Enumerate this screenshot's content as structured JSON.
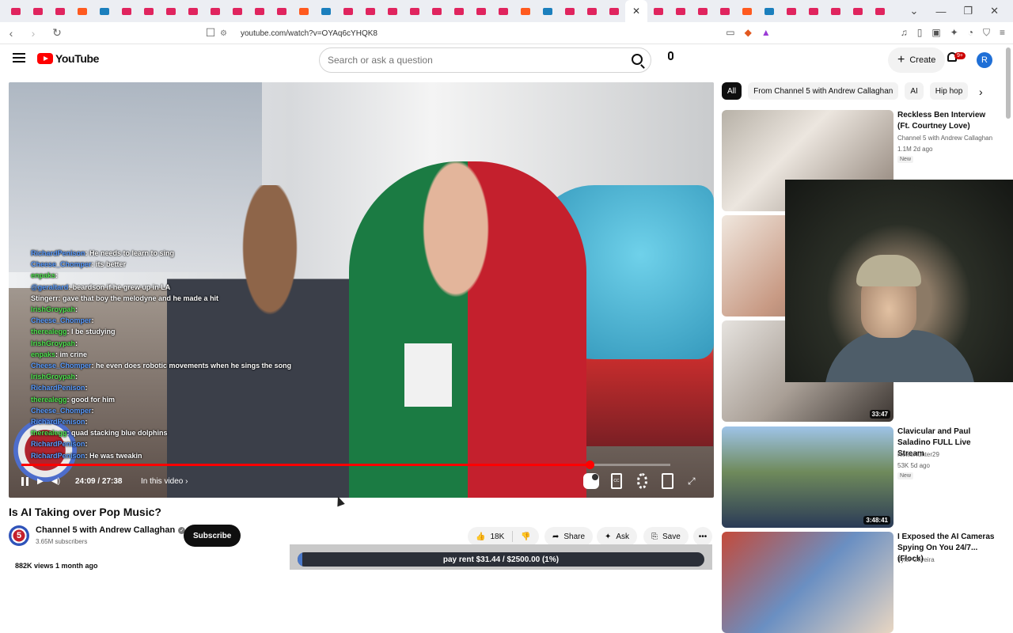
{
  "browser": {
    "url": "youtube.com/watch?v=OYAq6cYHQK8",
    "tab_count": 40
  },
  "header": {
    "logo_text": "YouTube",
    "search_placeholder": "Search or ask a question",
    "create_label": "Create",
    "notif_badge": "9+",
    "avatar_letter": "R"
  },
  "player": {
    "time": "24:09 / 27:38",
    "in_video": "In this video",
    "progress": 0.876,
    "chat": [
      {
        "user": "RichardPenison",
        "msg": "He needs to learn to sing",
        "style": "b"
      },
      {
        "user": "Cheese_Chomper",
        "msg": "its better",
        "style": "b"
      },
      {
        "user": "enpaks",
        "msg": "",
        "style": "g"
      },
      {
        "user": "@geraltard",
        "msg": "beardson if he grew up in LA",
        "style": "b"
      },
      {
        "user": "Stingerr",
        "msg": "gave that boy the melodyne and he made a hit",
        "style": "w"
      },
      {
        "user": "IrishGroypah",
        "msg": "",
        "style": "g"
      },
      {
        "user": "Cheese_Chomper",
        "msg": "",
        "style": "b"
      },
      {
        "user": "therealegg",
        "msg": "I be studying",
        "style": "g"
      },
      {
        "user": "IrishGroypah",
        "msg": "",
        "style": "g"
      },
      {
        "user": "enpaks",
        "msg": "im crine",
        "style": "g"
      },
      {
        "user": "Cheese_Chomper",
        "msg": "he even does robotic movements when he sings the song",
        "style": "b"
      },
      {
        "user": "IrishGroypah",
        "msg": "",
        "style": "g"
      },
      {
        "user": "RichardPenison",
        "msg": "",
        "style": "b"
      },
      {
        "user": "therealegg",
        "msg": "good for him",
        "style": "g"
      },
      {
        "user": "Cheese_Chomper",
        "msg": "",
        "style": "b"
      },
      {
        "user": "RichardPenison",
        "msg": "",
        "style": "b"
      },
      {
        "user": "therealegg",
        "msg": "quad stacking blue dolphins",
        "style": "g"
      },
      {
        "user": "RichardPenison",
        "msg": "",
        "style": "b"
      },
      {
        "user": "RichardPenison",
        "msg": "He was tweakin",
        "style": "b"
      }
    ]
  },
  "video": {
    "title": "Is AI Taking over Pop Music?",
    "channel": "Channel 5 with Andrew Callaghan",
    "subscribers": "3.65M subscribers",
    "subscribe_label": "Subscribe",
    "likes": "18K",
    "share_label": "Share",
    "ask_label": "Ask",
    "save_label": "Save",
    "views": "882K views  1 month ago"
  },
  "overlay": {
    "rent_text": "pay rent $31.44 / $2500.00 (1%)",
    "rent_progress": 0.0126
  },
  "sidebar": {
    "chips": [
      "All",
      "From Channel 5 with Andrew Callaghan",
      "AI",
      "Hip hop"
    ],
    "recommendations": [
      {
        "title": "Reckless Ben Interview (Ft. Courtney Love)",
        "channel": "Channel 5 with Andrew Callaghan",
        "meta": "1.1M  2d ago",
        "badge": "New",
        "duration": ""
      },
      {
        "title": "",
        "channel": "",
        "meta": "",
        "badge": "",
        "duration": ""
      },
      {
        "title": "",
        "channel": "",
        "meta": "",
        "badge": "",
        "duration": "33:47"
      },
      {
        "title": "Clavicular and Paul Saladino FULL Live Stream",
        "channel": "NewsHunter29",
        "meta": "53K  5d ago",
        "badge": "New",
        "duration": "3:48:41"
      },
      {
        "title": "I Exposed the AI Cameras Spying On You 24/7... (Flock)",
        "channel": "Tyler Oliveira",
        "meta": "",
        "badge": "",
        "duration": ""
      }
    ]
  }
}
